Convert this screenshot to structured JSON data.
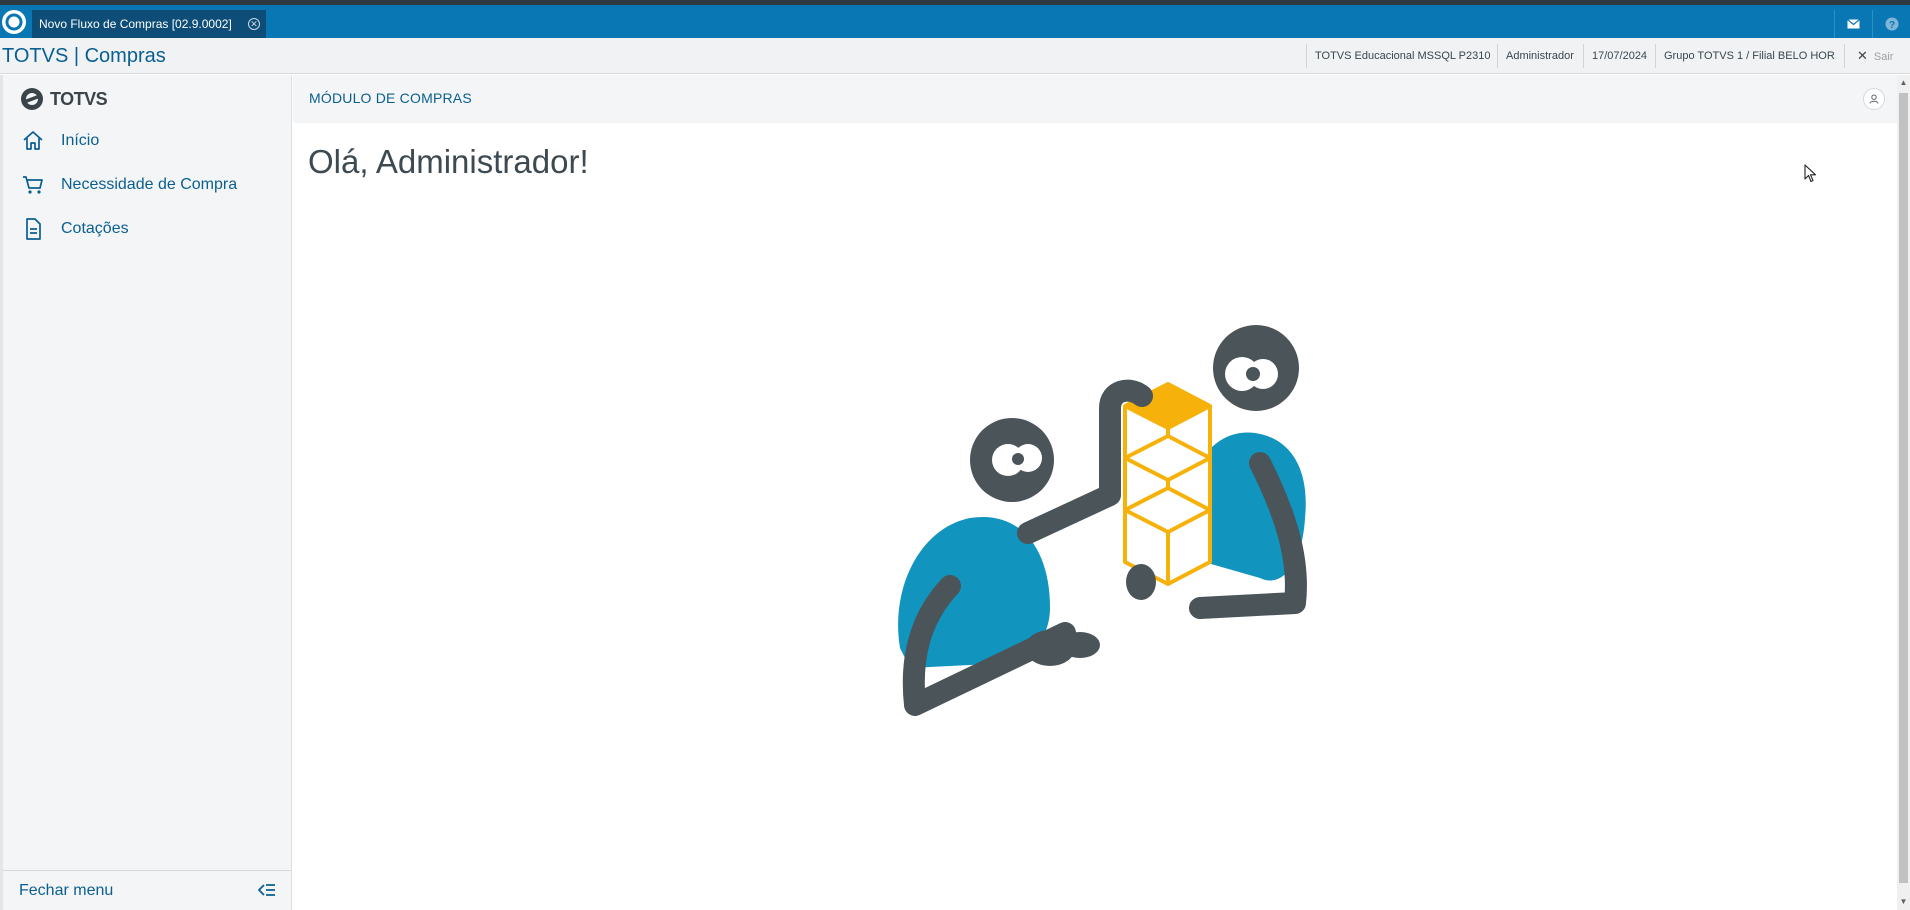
{
  "window": {
    "tab_title": "Novo Fluxo de Compras [02.9.0002]"
  },
  "header": {
    "brand": "TOTVS | Compras",
    "environment": "TOTVS Educacional MSSQL P2310",
    "user": "Administrador",
    "date": "17/07/2024",
    "branch": "Grupo TOTVS 1 / Filial BELO HOR",
    "exit_label": "Sair"
  },
  "sidebar": {
    "logo_text": "TOTVS",
    "items": [
      {
        "label": "Início",
        "icon": "home-icon"
      },
      {
        "label": "Necessidade de Compra",
        "icon": "cart-icon"
      },
      {
        "label": "Cotações",
        "icon": "document-icon"
      }
    ],
    "footer_label": "Fechar menu"
  },
  "main": {
    "module_title": "MÓDULO DE COMPRAS",
    "greeting": "Olá, Administrador!"
  },
  "colors": {
    "primary": "#0a77b5",
    "tab_active": "#0d4d77",
    "link": "#0a5f92",
    "illustration_blue": "#1195bf",
    "illustration_gray": "#4a5459",
    "illustration_yellow": "#f6b10b"
  }
}
